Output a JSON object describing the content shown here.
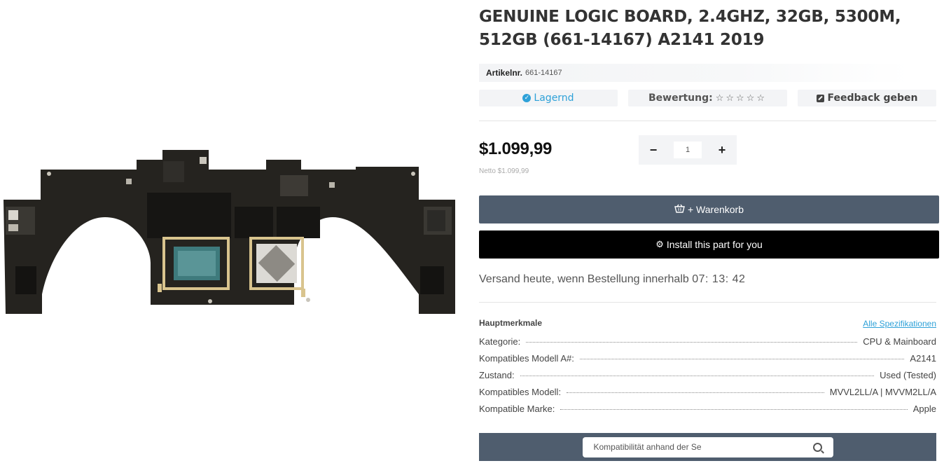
{
  "product": {
    "title": "GENUINE LOGIC BOARD, 2.4GHZ, 32GB, 5300M, 512GB (661-14167) A2141 2019",
    "image_name": "logic-board-photo"
  },
  "sku": {
    "label": "Artikelnr.",
    "value": "661-14167"
  },
  "meta": {
    "stock": "Lagernd",
    "rating_label": "Bewertung:",
    "stars": "☆☆☆☆☆",
    "feedback": "Feedback geben"
  },
  "pricing": {
    "price": "$1.099,99",
    "netto": "Netto $1.099,99"
  },
  "quantity": {
    "minus": "−",
    "value": "1",
    "plus": "+"
  },
  "actions": {
    "cart": "+ Warenkorb",
    "install": "Install this part for you"
  },
  "shipping": {
    "text": "Versand heute, wenn Bestellung innerhalb",
    "timer": "07: 13: 42"
  },
  "specs": {
    "heading": "Hauptmerkmale",
    "all_link": "Alle Spezifikationen",
    "rows": [
      {
        "key": "Kategorie:",
        "value": "CPU & Mainboard"
      },
      {
        "key": "Kompatibles Modell A#:",
        "value": "A2141"
      },
      {
        "key": "Zustand:",
        "value": "Used (Tested)"
      },
      {
        "key": "Kompatibles Modell:",
        "value": "MVVL2LL/A | MVVM2LL/A"
      },
      {
        "key": "Kompatible Marke:",
        "value": "Apple"
      }
    ]
  },
  "compat": {
    "placeholder": "Kompatibilität anhand der Se"
  },
  "colors": {
    "accent": "#2ea1d8",
    "cart_button": "#4f5d6e",
    "install_button": "#000000"
  }
}
